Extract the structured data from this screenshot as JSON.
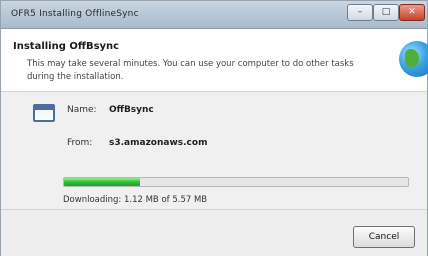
{
  "window": {
    "title": "OFR5 Installing OfflineSync",
    "buttons": {
      "minimize": "–",
      "maximize": "□",
      "close": "✕"
    }
  },
  "header": {
    "title": "Installing OffBsync",
    "description": "This may take several minutes. You can use your computer to do other tasks during the installation."
  },
  "details": {
    "name_label": "Name:",
    "name_value": "OffBsync",
    "from_label": "From:",
    "from_value": "s3.amazonaws.com"
  },
  "progress": {
    "fraction": 0.22,
    "status": "Downloading: 1.12 MB of 5.57 MB"
  },
  "footer": {
    "cancel_label": "Cancel"
  },
  "icons": {
    "app": "window-icon",
    "brand": "globe-icon"
  },
  "colors": {
    "progress": "#2fbe3a",
    "accent": "#1d6fb3"
  }
}
